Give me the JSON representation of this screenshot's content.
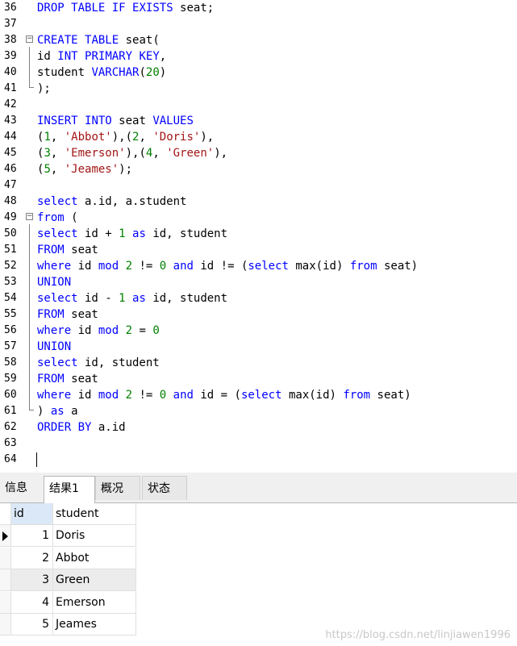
{
  "editor": {
    "lines": [
      {
        "n": "36",
        "t": "DROP TABLE IF EXISTS seat;"
      },
      {
        "n": "37",
        "t": ""
      },
      {
        "n": "38",
        "t": "CREATE TABLE seat("
      },
      {
        "n": "39",
        "t": "id INT PRIMARY KEY,"
      },
      {
        "n": "40",
        "t": "student VARCHAR(20)"
      },
      {
        "n": "41",
        "t": ");"
      },
      {
        "n": "42",
        "t": ""
      },
      {
        "n": "43",
        "t": "INSERT INTO seat VALUES"
      },
      {
        "n": "44",
        "t": "(1, 'Abbot'),(2, 'Doris'),"
      },
      {
        "n": "45",
        "t": "(3, 'Emerson'),(4, 'Green'),"
      },
      {
        "n": "46",
        "t": "(5, 'Jeames');"
      },
      {
        "n": "47",
        "t": ""
      },
      {
        "n": "48",
        "t": "select a.id, a.student"
      },
      {
        "n": "49",
        "t": "from ("
      },
      {
        "n": "50",
        "t": "select id + 1 as id, student"
      },
      {
        "n": "51",
        "t": "FROM seat"
      },
      {
        "n": "52",
        "t": "where id mod 2 != 0 and id != (select max(id) from seat)"
      },
      {
        "n": "53",
        "t": "UNION"
      },
      {
        "n": "54",
        "t": "select id - 1 as id, student"
      },
      {
        "n": "55",
        "t": "FROM seat"
      },
      {
        "n": "56",
        "t": "where id mod 2 = 0"
      },
      {
        "n": "57",
        "t": "UNION"
      },
      {
        "n": "58",
        "t": "select id, student"
      },
      {
        "n": "59",
        "t": "FROM seat"
      },
      {
        "n": "60",
        "t": "where id mod 2 != 0 and id = (select max(id) from seat)"
      },
      {
        "n": "61",
        "t": ") as a"
      },
      {
        "n": "62",
        "t": "ORDER BY a.id"
      },
      {
        "n": "63",
        "t": ""
      },
      {
        "n": "64",
        "t": ""
      }
    ]
  },
  "tabs": [
    {
      "label": "信息",
      "active": false
    },
    {
      "label": "结果1",
      "active": true
    },
    {
      "label": "概况",
      "active": false
    },
    {
      "label": "状态",
      "active": false
    }
  ],
  "grid": {
    "columns": [
      "id",
      "student"
    ],
    "rows": [
      {
        "id": "1",
        "student": "Doris"
      },
      {
        "id": "2",
        "student": "Abbot"
      },
      {
        "id": "3",
        "student": "Green"
      },
      {
        "id": "4",
        "student": "Emerson"
      },
      {
        "id": "5",
        "student": "Jeames"
      }
    ]
  },
  "watermark": "https://blog.csdn.net/linjiawen1996"
}
